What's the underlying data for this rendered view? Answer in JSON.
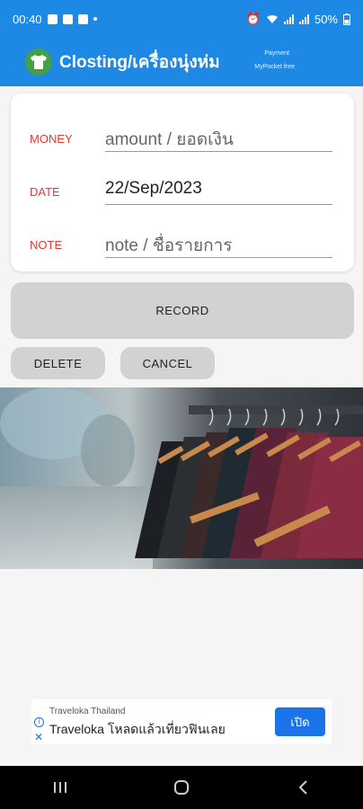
{
  "status_bar": {
    "time": "00:40",
    "battery": "50%"
  },
  "app_bar": {
    "title": "Closting/เครื่องนุ่งห่ม",
    "link_payment": "Payment",
    "link_mypocket": "MyPocket free"
  },
  "form": {
    "money_label": "MONEY",
    "money_placeholder": "amount / ยอดเงิน",
    "date_label": "DATE",
    "date_value": "22/Sep/2023",
    "note_label": "NOTE",
    "note_placeholder": "note / ชื่อรายการ"
  },
  "buttons": {
    "record": "RECORD",
    "delete": "DELETE",
    "cancel": "CANCEL"
  },
  "ad": {
    "sponsor": "Traveloka Thailand",
    "headline": "Traveloka โหลดแล้วเที่ยวฟินเลย",
    "cta": "เปิด"
  },
  "colors": {
    "primary": "#1e88e5",
    "label_red": "#e53935",
    "button_gray": "#d2d2d2",
    "ad_blue": "#1a73e8"
  }
}
